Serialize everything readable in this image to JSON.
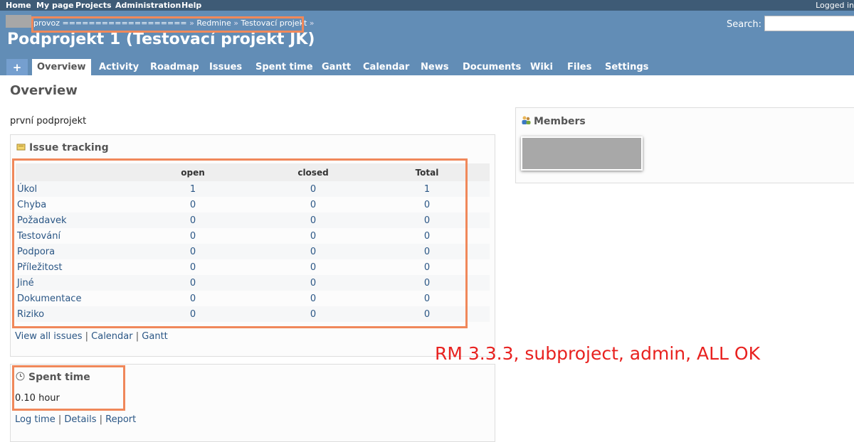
{
  "top_menu": {
    "items": [
      "Home",
      "My page",
      "Projects",
      "Administration",
      "Help"
    ],
    "logged_in": "Logged in"
  },
  "header": {
    "breadcrumb": {
      "part1": "provoz ===================",
      "sep": "»",
      "part2": "Redmine",
      "part3": "Testovací projekt",
      "trail": "»"
    },
    "search_label": "Search:",
    "search_value": "",
    "title": "Podprojekt 1 (Testovací projekt JK)"
  },
  "main_menu": {
    "new": "+",
    "tabs": [
      "Overview",
      "Activity",
      "Roadmap",
      "Issues",
      "Spent time",
      "Gantt",
      "Calendar",
      "News",
      "Documents",
      "Wiki",
      "Files",
      "Settings"
    ],
    "selected": "Overview"
  },
  "page": {
    "title": "Overview",
    "description": "první podprojekt"
  },
  "issue_tracking": {
    "heading": "Issue tracking",
    "columns": [
      "",
      "open",
      "closed",
      "Total"
    ],
    "rows": [
      {
        "name": "Úkol",
        "open": "1",
        "closed": "0",
        "total": "1"
      },
      {
        "name": "Chyba",
        "open": "0",
        "closed": "0",
        "total": "0"
      },
      {
        "name": "Požadavek",
        "open": "0",
        "closed": "0",
        "total": "0"
      },
      {
        "name": "Testování",
        "open": "0",
        "closed": "0",
        "total": "0"
      },
      {
        "name": "Podpora",
        "open": "0",
        "closed": "0",
        "total": "0"
      },
      {
        "name": "Příležitost",
        "open": "0",
        "closed": "0",
        "total": "0"
      },
      {
        "name": "Jiné",
        "open": "0",
        "closed": "0",
        "total": "0"
      },
      {
        "name": "Dokumentace",
        "open": "0",
        "closed": "0",
        "total": "0"
      },
      {
        "name": "Riziko",
        "open": "0",
        "closed": "0",
        "total": "0"
      }
    ],
    "links": [
      "View all issues",
      "Calendar",
      "Gantt"
    ],
    "link_sep": "|"
  },
  "spent_time": {
    "heading": "Spent time",
    "value": "0.10 hour",
    "links": [
      "Log time",
      "Details",
      "Report"
    ]
  },
  "members": {
    "heading": "Members"
  },
  "annotation": "RM 3.3.3, subproject, admin, ALL OK",
  "colors": {
    "header": "#628db6",
    "top_menu": "#3e5b76",
    "link": "#2a5685",
    "highlight": "#f0885a",
    "annotation": "#e8211f"
  }
}
